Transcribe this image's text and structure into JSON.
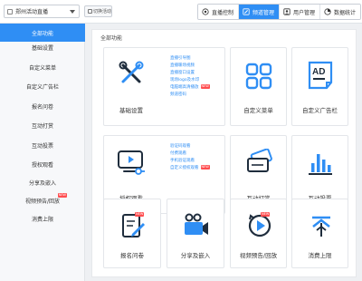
{
  "topbar": {
    "event_select_value": "郑州活动直播",
    "switch_label": "切换活动",
    "tabs": [
      {
        "label": "直播控制",
        "icon": "broadcast-icon",
        "active": false
      },
      {
        "label": "频道管理",
        "icon": "edit-icon",
        "active": true
      },
      {
        "label": "用户管理",
        "icon": "user-icon",
        "active": false
      },
      {
        "label": "数据统计",
        "icon": "stats-icon",
        "active": false
      }
    ]
  },
  "sidebar": {
    "items": [
      {
        "label": "全部功能",
        "active": true
      },
      {
        "label": "基础设置"
      },
      {
        "label": "自定义菜单"
      },
      {
        "label": "自定义广告栏"
      },
      {
        "label": "报名问卷"
      },
      {
        "label": "互动打赏"
      },
      {
        "label": "互动投票"
      },
      {
        "label": "授权观看"
      },
      {
        "label": "分享及嵌入"
      },
      {
        "label": "视频预告/回放",
        "badge": "NEW"
      },
      {
        "label": "消费上限"
      }
    ]
  },
  "main": {
    "title": "全部功能",
    "new_badge": "NEW",
    "cards": {
      "basic": {
        "label": "基础设置",
        "icon": "tools-icon",
        "links": [
          "直播引导图",
          "直播暖场视频",
          "直播窗口设置",
          "现场logo及水印",
          "电脑端高清播放",
          "频道密码"
        ],
        "link_badge_index": 4
      },
      "menu": {
        "label": "自定义菜单",
        "icon": "grid-icon"
      },
      "ad": {
        "label": "自定义广告栏",
        "icon": "ad-icon"
      },
      "auth": {
        "label": "授权观看",
        "icon": "auth-icon",
        "links": [
          "验证码观看",
          "付费观看",
          "手机验证观看",
          "自定义授权观看"
        ],
        "link_badge_index": 3
      },
      "reward": {
        "label": "互动打赏",
        "icon": "ticket-icon"
      },
      "vote": {
        "label": "互动投票",
        "icon": "bar-chart-icon"
      },
      "signup": {
        "label": "报名问卷",
        "icon": "form-icon",
        "badge": "NEW"
      },
      "share": {
        "label": "分享及嵌入",
        "icon": "camera-icon"
      },
      "preview": {
        "label": "视频预告/回放",
        "icon": "replay-icon",
        "badge": "NEW"
      },
      "limit": {
        "label": "消费上限",
        "icon": "limit-icon"
      }
    }
  },
  "colors": {
    "accent": "#2f8ef4",
    "badge": "#ff4d4f",
    "sidebar_bg": "#f7f8fa"
  }
}
